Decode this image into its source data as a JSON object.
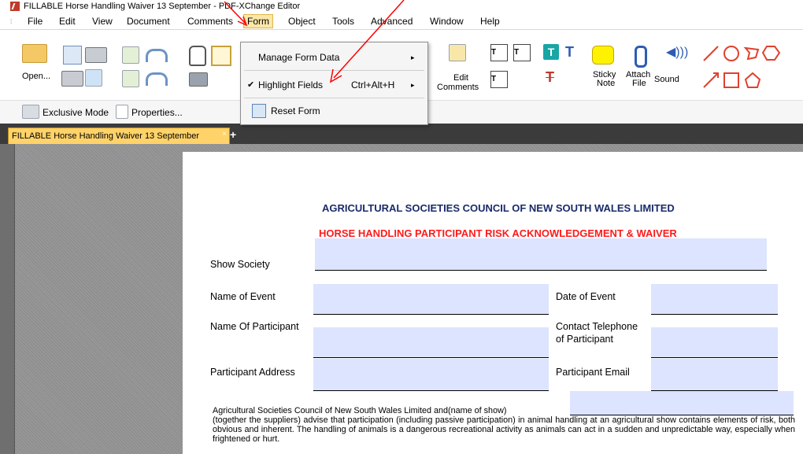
{
  "window": {
    "title": "FILLABLE Horse Handling Waiver 13 September - PDF-XChange Editor"
  },
  "menubar": [
    "File",
    "Edit",
    "View",
    "Document",
    "Comments",
    "Form",
    "Object",
    "Tools",
    "Advanced",
    "Window",
    "Help"
  ],
  "menubar_active": "Form",
  "toolbar": {
    "open_label": "Open...",
    "edit_comments_label_1": "Edit",
    "edit_comments_label_2": "Comments",
    "sticky_note_label_1": "Sticky",
    "sticky_note_label_2": "Note",
    "attach_file_label_1": "Attach",
    "attach_file_label_2": "File",
    "sound_label": "Sound"
  },
  "toolbar2": {
    "exclusive_mode_label": "Exclusive Mode",
    "properties_label": "Properties..."
  },
  "form_menu": {
    "items": [
      {
        "label": "Manage Form Data",
        "submenu": "▸"
      },
      {
        "label": "Highlight Fields",
        "checked": "✔",
        "shortcut": "Ctrl+Alt+H",
        "submenu": "▸"
      },
      {
        "label": "Reset Form"
      }
    ]
  },
  "tabs": {
    "doc_tab": "FILLABLE Horse Handling Waiver 13 September",
    "close": "×",
    "new_tab": "+"
  },
  "document": {
    "heading": "AGRICULTURAL SOCIETIES COUNCIL OF NEW SOUTH WALES LIMITED",
    "subheading": "HORSE HANDLING PARTICIPANT RISK ACKNOWLEDGEMENT & WAIVER",
    "labels": {
      "show_society": "Show Society",
      "name_of_event": "Name of Event",
      "date_of_event": "Date of Event",
      "name_of_participant": "Name Of Participant",
      "contact_telephone_1": "Contact  Telephone",
      "contact_telephone_2": "of Participant",
      "participant_address": "Participant Address",
      "participant_email": "Participant Email"
    },
    "paragraph_line1": "Agricultural Societies Council of New South Wales Limited and(name of show)",
    "paragraph_rest": "(together the suppliers) advise that participation (including passive participation) in animal handling at an agricultural show contains elements of risk, both obvious and inherent.  The handling of animals is a dangerous recreational activity as animals can act in a sudden and unpredictable way, especially when frightened or hurt."
  },
  "colors": {
    "form_field": "#dce4ff",
    "heading_blue": "#1a2b6b",
    "heading_red": "#ff1a1a",
    "annotation_arrow": "#ff0000",
    "active_tab": "#ffd36a"
  }
}
